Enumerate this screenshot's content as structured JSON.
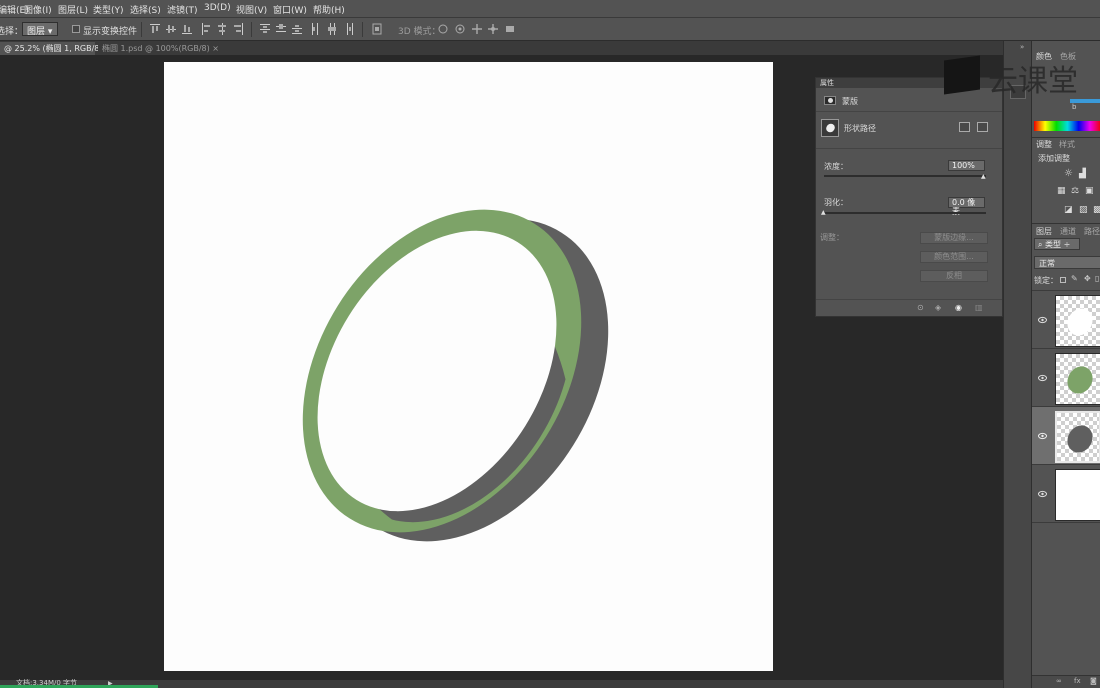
{
  "menubar": {
    "items": [
      "编辑(E)",
      "图像(I)",
      "图层(L)",
      "类型(Y)",
      "选择(S)",
      "滤镜(T)",
      "3D(D)",
      "视图(V)",
      "窗口(W)",
      "帮助(H)"
    ]
  },
  "options": {
    "select_label": "选择：",
    "select_value": "图层",
    "transform_checkbox_label": "显示变换控件",
    "mode_3d_label": "3D 模式："
  },
  "tabs": [
    {
      "label": "@ 25.2% (椭圆 1, RGB/8) *",
      "active": true
    },
    {
      "label": "椭圆 1.psd @ 100%(RGB/8)",
      "active": false
    }
  ],
  "properties_panel": {
    "title": "属性",
    "mask_label": "蒙版",
    "shape_label": "形状路径",
    "density_label": "浓度：",
    "density_value": "100%",
    "feather_label": "羽化：",
    "feather_value": "0.0 像素",
    "adjust_label": "调整：",
    "btn_mask_edge": "蒙版边缘...",
    "btn_color_range": "颜色范围...",
    "btn_invert": "反相"
  },
  "right_dock": {
    "color_tab": "颜色",
    "swatches_tab": "色板",
    "adjustments_tab": "调整",
    "styles_tab": "样式",
    "add_adjustment_label": "添加调整",
    "layers_tab": "图层",
    "channels_tab": "通道",
    "paths_tab": "路径",
    "kind_filter": "类型",
    "blend_mode": "正常",
    "lock_label": "锁定："
  },
  "canvas": {
    "ring_color": "#7da368",
    "shadow_color": "#5f5f5f",
    "background_color": "#fdfdfd"
  },
  "statusbar": {
    "doc_info": "文档:3.34M/0 字节"
  },
  "watermark": {
    "text": "云课堂"
  },
  "layers": [
    {
      "thumb": "white-ellipse"
    },
    {
      "thumb": "green-ellipse"
    },
    {
      "thumb": "gray-ellipse"
    },
    {
      "thumb": "white-fill"
    }
  ]
}
